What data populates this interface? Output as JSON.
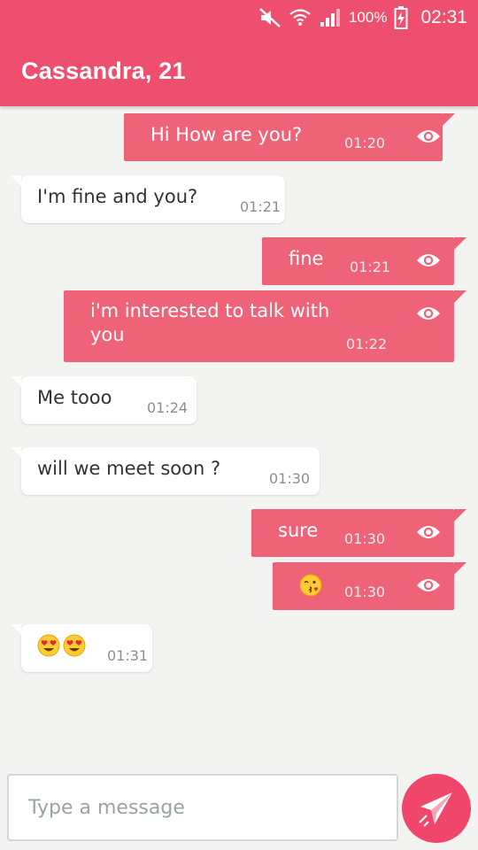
{
  "status_bar": {
    "icons": [
      "mute-icon",
      "wifi-icon",
      "signal-icon",
      "battery-charging-icon"
    ],
    "battery": "100%",
    "time": "02:31"
  },
  "header": {
    "title": "Cassandra, 21"
  },
  "messages": [
    {
      "direction": "sent",
      "text": "Hi How are you?",
      "time": "01:20",
      "seen": true
    },
    {
      "direction": "received",
      "text": "I'm fine and you?",
      "time": "01:21"
    },
    {
      "direction": "sent",
      "text": "fine",
      "time": "01:21",
      "seen": true
    },
    {
      "direction": "sent",
      "text": "i'm interested to talk with you",
      "time": "01:22",
      "seen": true
    },
    {
      "direction": "received",
      "text": "Me tooo",
      "time": "01:24"
    },
    {
      "direction": "received",
      "text": "will we meet soon ?",
      "time": "01:30"
    },
    {
      "direction": "sent",
      "text": "sure",
      "time": "01:30",
      "seen": true
    },
    {
      "direction": "sent",
      "emoji": [
        "kissing-face-emoji"
      ],
      "time": "01:30",
      "seen": true
    },
    {
      "direction": "received",
      "emoji": [
        "heart-eyes-emoji",
        "heart-eyes-emoji"
      ],
      "time": "01:31"
    }
  ],
  "composer": {
    "placeholder": "Type a message",
    "value": ""
  },
  "send_button": {
    "icon": "paper-plane-icon"
  },
  "colors": {
    "primary": "#ef4f6e",
    "sent_bubble": "#ef6379",
    "received_bubble": "#ffffff",
    "background": "#f3f3f1",
    "send_button": "#f0466c"
  }
}
